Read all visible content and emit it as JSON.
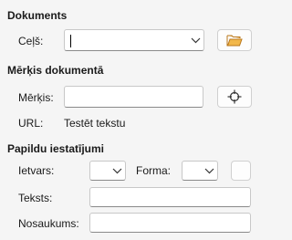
{
  "document": {
    "section_title": "Dokuments",
    "path_label": "Ceļš:",
    "path_value": ""
  },
  "target": {
    "section_title": "Mērķis dokumentā",
    "target_label": "Mērķis:",
    "target_value": "",
    "url_label": "URL:",
    "url_value": "Testēt tekstu"
  },
  "further": {
    "section_title": "Papildu iestatījumi",
    "frame_label": "Ietvars:",
    "frame_value": "",
    "form_label": "Forma:",
    "form_value": "",
    "text_label": "Teksts:",
    "text_value": "",
    "name_label": "Nosaukums:",
    "name_value": ""
  },
  "icons": {
    "open_folder": "folder-open-icon",
    "target_picker": "crosshair-icon",
    "dropdown": "chevron-down-icon"
  }
}
